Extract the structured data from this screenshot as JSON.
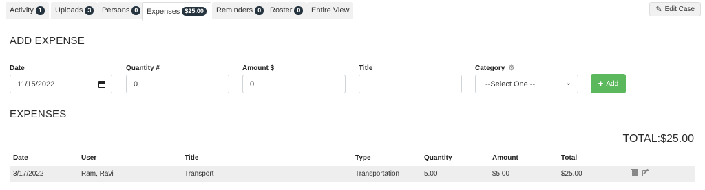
{
  "tabs": [
    {
      "label": "Activity",
      "badge": "1"
    },
    {
      "label": "Uploads",
      "badge": "3"
    },
    {
      "label": "Persons",
      "badge": "0"
    },
    {
      "label": "Expenses",
      "badge": "$25.00"
    },
    {
      "label": "Reminders",
      "badge": "0"
    },
    {
      "label": "Roster",
      "badge": "0"
    },
    {
      "label": "Entire View",
      "badge": ""
    }
  ],
  "edit_case_label": "Edit Case",
  "add_expense": {
    "title": "ADD EXPENSE",
    "date_label": "Date",
    "date_value": "11/15/2022",
    "quantity_label": "Quantity #",
    "quantity_value": "0",
    "amount_label": "Amount $",
    "amount_value": "0",
    "title_label": "Title",
    "title_value": "",
    "category_label": "Category",
    "category_value": "--Select One --",
    "add_button_label": "Add"
  },
  "expenses": {
    "title": "EXPENSES",
    "total_label": "TOTAL:$25.00",
    "columns": [
      "Date",
      "User",
      "Title",
      "Type",
      "Quantity",
      "Amount",
      "Total"
    ],
    "rows": [
      {
        "date": "3/17/2022",
        "user": "Ram, Ravi",
        "title": "Transport",
        "type": "Transportation",
        "quantity": "5.00",
        "amount": "$5.00",
        "total": "$25.00"
      }
    ]
  },
  "colors": {
    "accent_green": "#5cb85c",
    "badge_dark": "#26343f",
    "row_bg": "#eeeeee"
  }
}
